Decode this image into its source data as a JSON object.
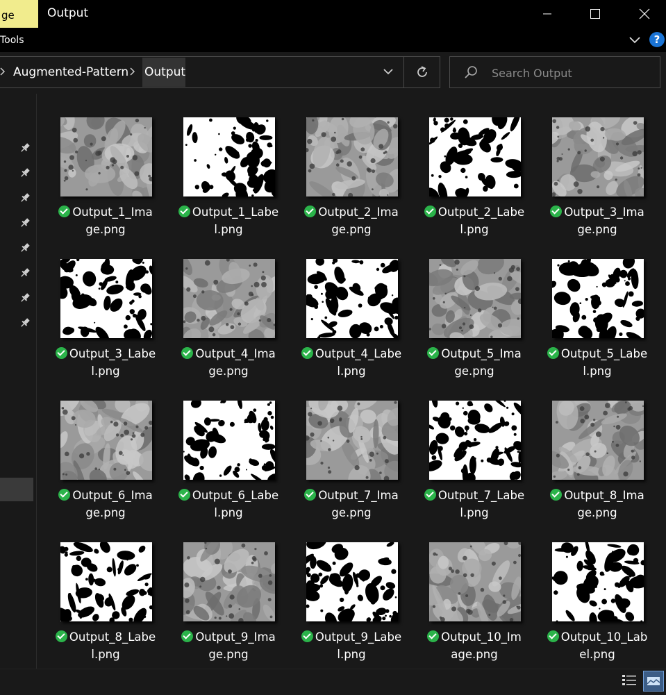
{
  "window": {
    "ribbon_tab_label": "ge",
    "title": "Output",
    "ribbon_tools_label": "Tools",
    "help_label": "?"
  },
  "address": {
    "crumbs": [
      "Augmented-Pattern",
      "Output"
    ]
  },
  "search": {
    "placeholder": "Search Output"
  },
  "files": [
    {
      "name_l1": "Output_1_Ima",
      "name_l2": "ge.png",
      "kind": "image"
    },
    {
      "name_l1": "Output_1_Labe",
      "name_l2": "l.png",
      "kind": "label"
    },
    {
      "name_l1": "Output_2_Ima",
      "name_l2": "ge.png",
      "kind": "image"
    },
    {
      "name_l1": "Output_2_Labe",
      "name_l2": "l.png",
      "kind": "label"
    },
    {
      "name_l1": "Output_3_Ima",
      "name_l2": "ge.png",
      "kind": "image"
    },
    {
      "name_l1": "Output_3_Labe",
      "name_l2": "l.png",
      "kind": "label"
    },
    {
      "name_l1": "Output_4_Ima",
      "name_l2": "ge.png",
      "kind": "image"
    },
    {
      "name_l1": "Output_4_Labe",
      "name_l2": "l.png",
      "kind": "label"
    },
    {
      "name_l1": "Output_5_Ima",
      "name_l2": "ge.png",
      "kind": "image"
    },
    {
      "name_l1": "Output_5_Labe",
      "name_l2": "l.png",
      "kind": "label"
    },
    {
      "name_l1": "Output_6_Ima",
      "name_l2": "ge.png",
      "kind": "image"
    },
    {
      "name_l1": "Output_6_Labe",
      "name_l2": "l.png",
      "kind": "label"
    },
    {
      "name_l1": "Output_7_Ima",
      "name_l2": "ge.png",
      "kind": "image"
    },
    {
      "name_l1": "Output_7_Labe",
      "name_l2": "l.png",
      "kind": "label"
    },
    {
      "name_l1": "Output_8_Ima",
      "name_l2": "ge.png",
      "kind": "image"
    },
    {
      "name_l1": "Output_8_Labe",
      "name_l2": "l.png",
      "kind": "label"
    },
    {
      "name_l1": "Output_9_Ima",
      "name_l2": "ge.png",
      "kind": "image"
    },
    {
      "name_l1": "Output_9_Labe",
      "name_l2": "l.png",
      "kind": "label"
    },
    {
      "name_l1": "Output_10_Im",
      "name_l2": "age.png",
      "kind": "image"
    },
    {
      "name_l1": "Output_10_Lab",
      "name_l2": "el.png",
      "kind": "label"
    }
  ],
  "colors": {
    "background": "#191919",
    "titlebar": "#000000",
    "ribbon_tab": "#f1ec8d",
    "sync_ok": "#2bb34a",
    "help": "#1a73d4"
  },
  "icons": [
    "minimize-icon",
    "maximize-icon",
    "close-icon",
    "chevron-down-icon",
    "help-icon",
    "refresh-icon",
    "search-icon",
    "pin-icon",
    "details-view-icon",
    "large-icons-view-icon"
  ]
}
